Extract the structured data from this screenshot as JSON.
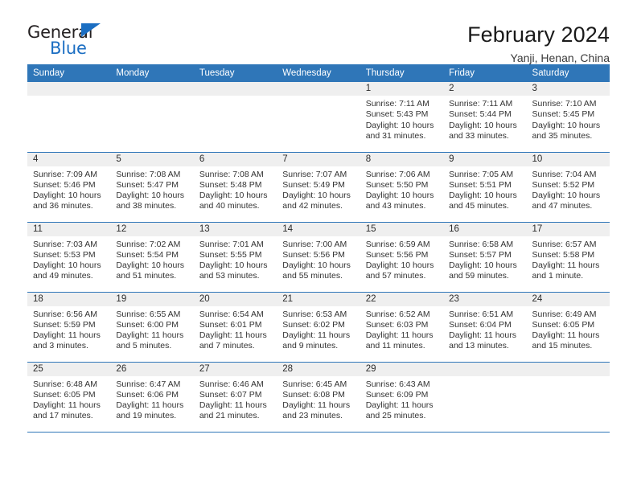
{
  "brand": {
    "name_part1": "General",
    "name_part2": "Blue",
    "accent_color": "#1b6ec2"
  },
  "header": {
    "title": "February 2024",
    "subtitle": "Yanji, Henan, China"
  },
  "calendar": {
    "header_color": "#2f76b8",
    "daynum_band_color": "#efefef",
    "weekday_headers": [
      "Sunday",
      "Monday",
      "Tuesday",
      "Wednesday",
      "Thursday",
      "Friday",
      "Saturday"
    ],
    "weeks": [
      [
        {
          "day": "",
          "sunrise": "",
          "sunset": "",
          "daylight_line1": "",
          "daylight_line2": ""
        },
        {
          "day": "",
          "sunrise": "",
          "sunset": "",
          "daylight_line1": "",
          "daylight_line2": ""
        },
        {
          "day": "",
          "sunrise": "",
          "sunset": "",
          "daylight_line1": "",
          "daylight_line2": ""
        },
        {
          "day": "",
          "sunrise": "",
          "sunset": "",
          "daylight_line1": "",
          "daylight_line2": ""
        },
        {
          "day": "1",
          "sunrise": "Sunrise: 7:11 AM",
          "sunset": "Sunset: 5:43 PM",
          "daylight_line1": "Daylight: 10 hours",
          "daylight_line2": "and 31 minutes."
        },
        {
          "day": "2",
          "sunrise": "Sunrise: 7:11 AM",
          "sunset": "Sunset: 5:44 PM",
          "daylight_line1": "Daylight: 10 hours",
          "daylight_line2": "and 33 minutes."
        },
        {
          "day": "3",
          "sunrise": "Sunrise: 7:10 AM",
          "sunset": "Sunset: 5:45 PM",
          "daylight_line1": "Daylight: 10 hours",
          "daylight_line2": "and 35 minutes."
        }
      ],
      [
        {
          "day": "4",
          "sunrise": "Sunrise: 7:09 AM",
          "sunset": "Sunset: 5:46 PM",
          "daylight_line1": "Daylight: 10 hours",
          "daylight_line2": "and 36 minutes."
        },
        {
          "day": "5",
          "sunrise": "Sunrise: 7:08 AM",
          "sunset": "Sunset: 5:47 PM",
          "daylight_line1": "Daylight: 10 hours",
          "daylight_line2": "and 38 minutes."
        },
        {
          "day": "6",
          "sunrise": "Sunrise: 7:08 AM",
          "sunset": "Sunset: 5:48 PM",
          "daylight_line1": "Daylight: 10 hours",
          "daylight_line2": "and 40 minutes."
        },
        {
          "day": "7",
          "sunrise": "Sunrise: 7:07 AM",
          "sunset": "Sunset: 5:49 PM",
          "daylight_line1": "Daylight: 10 hours",
          "daylight_line2": "and 42 minutes."
        },
        {
          "day": "8",
          "sunrise": "Sunrise: 7:06 AM",
          "sunset": "Sunset: 5:50 PM",
          "daylight_line1": "Daylight: 10 hours",
          "daylight_line2": "and 43 minutes."
        },
        {
          "day": "9",
          "sunrise": "Sunrise: 7:05 AM",
          "sunset": "Sunset: 5:51 PM",
          "daylight_line1": "Daylight: 10 hours",
          "daylight_line2": "and 45 minutes."
        },
        {
          "day": "10",
          "sunrise": "Sunrise: 7:04 AM",
          "sunset": "Sunset: 5:52 PM",
          "daylight_line1": "Daylight: 10 hours",
          "daylight_line2": "and 47 minutes."
        }
      ],
      [
        {
          "day": "11",
          "sunrise": "Sunrise: 7:03 AM",
          "sunset": "Sunset: 5:53 PM",
          "daylight_line1": "Daylight: 10 hours",
          "daylight_line2": "and 49 minutes."
        },
        {
          "day": "12",
          "sunrise": "Sunrise: 7:02 AM",
          "sunset": "Sunset: 5:54 PM",
          "daylight_line1": "Daylight: 10 hours",
          "daylight_line2": "and 51 minutes."
        },
        {
          "day": "13",
          "sunrise": "Sunrise: 7:01 AM",
          "sunset": "Sunset: 5:55 PM",
          "daylight_line1": "Daylight: 10 hours",
          "daylight_line2": "and 53 minutes."
        },
        {
          "day": "14",
          "sunrise": "Sunrise: 7:00 AM",
          "sunset": "Sunset: 5:56 PM",
          "daylight_line1": "Daylight: 10 hours",
          "daylight_line2": "and 55 minutes."
        },
        {
          "day": "15",
          "sunrise": "Sunrise: 6:59 AM",
          "sunset": "Sunset: 5:56 PM",
          "daylight_line1": "Daylight: 10 hours",
          "daylight_line2": "and 57 minutes."
        },
        {
          "day": "16",
          "sunrise": "Sunrise: 6:58 AM",
          "sunset": "Sunset: 5:57 PM",
          "daylight_line1": "Daylight: 10 hours",
          "daylight_line2": "and 59 minutes."
        },
        {
          "day": "17",
          "sunrise": "Sunrise: 6:57 AM",
          "sunset": "Sunset: 5:58 PM",
          "daylight_line1": "Daylight: 11 hours",
          "daylight_line2": "and 1 minute."
        }
      ],
      [
        {
          "day": "18",
          "sunrise": "Sunrise: 6:56 AM",
          "sunset": "Sunset: 5:59 PM",
          "daylight_line1": "Daylight: 11 hours",
          "daylight_line2": "and 3 minutes."
        },
        {
          "day": "19",
          "sunrise": "Sunrise: 6:55 AM",
          "sunset": "Sunset: 6:00 PM",
          "daylight_line1": "Daylight: 11 hours",
          "daylight_line2": "and 5 minutes."
        },
        {
          "day": "20",
          "sunrise": "Sunrise: 6:54 AM",
          "sunset": "Sunset: 6:01 PM",
          "daylight_line1": "Daylight: 11 hours",
          "daylight_line2": "and 7 minutes."
        },
        {
          "day": "21",
          "sunrise": "Sunrise: 6:53 AM",
          "sunset": "Sunset: 6:02 PM",
          "daylight_line1": "Daylight: 11 hours",
          "daylight_line2": "and 9 minutes."
        },
        {
          "day": "22",
          "sunrise": "Sunrise: 6:52 AM",
          "sunset": "Sunset: 6:03 PM",
          "daylight_line1": "Daylight: 11 hours",
          "daylight_line2": "and 11 minutes."
        },
        {
          "day": "23",
          "sunrise": "Sunrise: 6:51 AM",
          "sunset": "Sunset: 6:04 PM",
          "daylight_line1": "Daylight: 11 hours",
          "daylight_line2": "and 13 minutes."
        },
        {
          "day": "24",
          "sunrise": "Sunrise: 6:49 AM",
          "sunset": "Sunset: 6:05 PM",
          "daylight_line1": "Daylight: 11 hours",
          "daylight_line2": "and 15 minutes."
        }
      ],
      [
        {
          "day": "25",
          "sunrise": "Sunrise: 6:48 AM",
          "sunset": "Sunset: 6:05 PM",
          "daylight_line1": "Daylight: 11 hours",
          "daylight_line2": "and 17 minutes."
        },
        {
          "day": "26",
          "sunrise": "Sunrise: 6:47 AM",
          "sunset": "Sunset: 6:06 PM",
          "daylight_line1": "Daylight: 11 hours",
          "daylight_line2": "and 19 minutes."
        },
        {
          "day": "27",
          "sunrise": "Sunrise: 6:46 AM",
          "sunset": "Sunset: 6:07 PM",
          "daylight_line1": "Daylight: 11 hours",
          "daylight_line2": "and 21 minutes."
        },
        {
          "day": "28",
          "sunrise": "Sunrise: 6:45 AM",
          "sunset": "Sunset: 6:08 PM",
          "daylight_line1": "Daylight: 11 hours",
          "daylight_line2": "and 23 minutes."
        },
        {
          "day": "29",
          "sunrise": "Sunrise: 6:43 AM",
          "sunset": "Sunset: 6:09 PM",
          "daylight_line1": "Daylight: 11 hours",
          "daylight_line2": "and 25 minutes."
        },
        {
          "day": "",
          "sunrise": "",
          "sunset": "",
          "daylight_line1": "",
          "daylight_line2": ""
        },
        {
          "day": "",
          "sunrise": "",
          "sunset": "",
          "daylight_line1": "",
          "daylight_line2": ""
        }
      ]
    ]
  }
}
